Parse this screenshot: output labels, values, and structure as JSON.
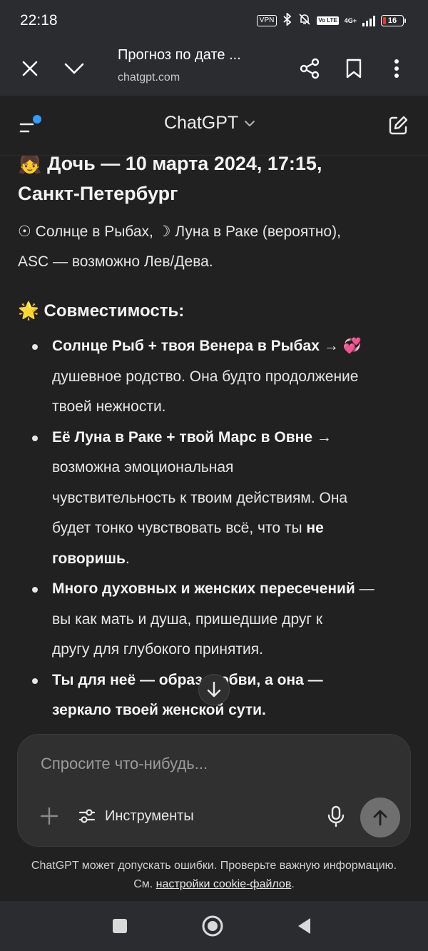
{
  "status_bar": {
    "time": "22:18",
    "vpn": "VPN",
    "network": "4G+",
    "volte": "Vo LTE",
    "battery": "16",
    "battery_color": "#e53935"
  },
  "browser": {
    "page_title": "Прогноз по дате ...",
    "url": "chatgpt.com"
  },
  "app": {
    "model_name": "ChatGPT",
    "icons": {
      "menu": "menu-icon",
      "new_chat": "edit-icon",
      "dropdown": "chevron-down-icon"
    }
  },
  "message": {
    "heading_line1": "👧 Дочь — 10 марта 2024, 17:15,",
    "heading_line2": "Санкт-Петербург",
    "para_line1": "☉ Солнце в Рыбах, ☽ Луна в Раке (вероятно),",
    "para_line2": "ASC — возможно Лев/Дева.",
    "section_title": "🌟 Совместимость:",
    "bullets": [
      {
        "bold": "Солнце Рыб + твоя Венера в Рыбах",
        "text_a": " → 💞",
        "text_b": "душевное родство. Она будто продолжение",
        "text_c": "твоей нежности."
      },
      {
        "bold": "Её Луна в Раке + твой Марс в Овне",
        "text_a": " →",
        "text_b": "возможна эмоциональная",
        "text_c": "чувствительность к твоим действиям. Она",
        "text_d": "будет тонко чувствовать всё, что ты ",
        "bold_2": "не",
        "bold_3": "говоришь",
        "text_e": "."
      },
      {
        "bold": "Много духовных и женских пересечений",
        "text_a": " —",
        "text_b": "вы как мать и душа, пришедшие друг к",
        "text_c": "другу для глубокого принятия."
      },
      {
        "bold": "Ты для неё — образ любви, а она —",
        "bold_2": "зеркало твоей женской сути."
      }
    ]
  },
  "composer": {
    "placeholder": "Спросите что-нибудь...",
    "tools_label": "Инструменты"
  },
  "disclaimer": {
    "text": "ChatGPT может допускать ошибки. Проверьте важную информацию. См. ",
    "link": "настройки cookie-файлов",
    "end": "."
  }
}
